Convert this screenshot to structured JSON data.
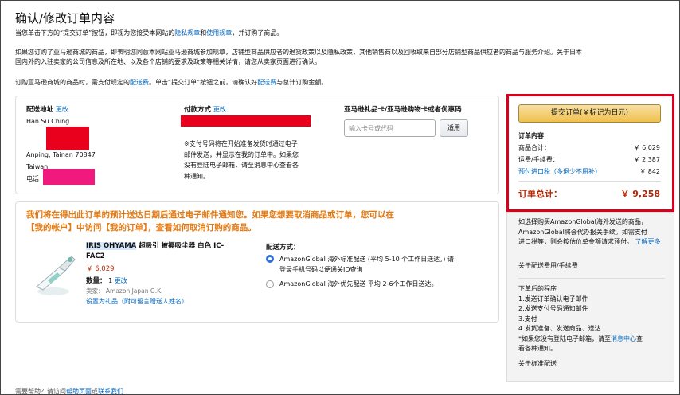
{
  "page_title": "确认/修改订单内容",
  "intro": {
    "p1_a": "当您单击下方的“提交订单”按钮，即视为您接受本网站的",
    "p1_link1": "隐私规章",
    "p1_and": "和",
    "p1_link2": "使用规章",
    "p1_b": "，并订购了商品。",
    "p2_line1": "如果您订购了亚马逊商城的商品，即表明您同意本网站亚马逊商城参加规章，店铺型商品供应者的退货政策以及隐私政策，其他销售商以及回收取来自部分店铺型商品供应者的商品与服务介绍。关于日本",
    "p2_line2": "国内外的入驻卖家的公司信息及所在地、以及各个店铺的要求及政策等相关详情，请您从卖家页面进行确认。",
    "p3_a": "订购亚马逊商城的商品时，需支付规定的",
    "p3_link1": "配送费",
    "p3_b": "。单击“提交订单”按钮之前，请确认好",
    "p3_link2": "配送费",
    "p3_c": "与总计订购金额。"
  },
  "address": {
    "label": "配送地址",
    "change": "更改",
    "name": "Han Su Ching",
    "line_city": "Anping, Tainan 70847",
    "country": "Taiwan",
    "phone_label": "电话"
  },
  "payment": {
    "label": "付款方式",
    "change": "更改",
    "note": [
      "※支付号码将在开始准备发货时通过电子",
      "邮件发送，并显示在我的订单中。如果您",
      "没有登陆电子邮箱，请至消息中心查看各",
      "种通知。"
    ]
  },
  "gift": {
    "label": "亚马逊礼品卡/亚马逊购物卡或者优惠码",
    "placeholder": "输入卡号或代码",
    "apply": "适用"
  },
  "notice": {
    "line1": "我们将在得出此订单的预计送达日期后通过电子邮件通知您。如果您想要取消商品或订单，您可以在",
    "line2": "【我的帐户】中访问【我的订单】，查看如何取消订购的商品。"
  },
  "product": {
    "brand": "IRIS OHYAMA",
    "title_rest": " 超吸引 被褥吸尘器 白色 IC-",
    "title_line2": "FAC2",
    "price": "￥ 6,029",
    "qty_label": "数量：",
    "qty": "1",
    "qty_change": "更改",
    "seller": "卖家： Amazon Japan G.K.",
    "gift_link": "设置为礼品（附可留言赠送人姓名）"
  },
  "shipping": {
    "label": "配送方式：",
    "opt1_line1": "AmazonGlobal 海外标准配送 (平均 5-10 个工作日送达。) 请",
    "opt1_line2": "登录手机号码以便通关ID查询",
    "opt2": "AmazonGlobal 海外优先配送  平均 2-6个工作日送达。"
  },
  "summary": {
    "submit": "提交订单(￥标记为日元)",
    "header": "订单内容",
    "items_label": "商品合计：",
    "items_value": "￥ 6,029",
    "ship_label": "运费/手续费：",
    "ship_value": "￥ 2,387",
    "import_label": "预付进口税（多退少不用补）",
    "import_value": "￥ 842",
    "total_label": "订单总计：",
    "total_value": "￥ 9,258"
  },
  "side_info": {
    "para1": [
      "如选择购买AmazonGlobal海外发送的商品，",
      "AmazonGlobal将会代办报关手续。如需支付",
      "进口税等，则会按估价单金额请求预付。"
    ],
    "para1_link": "了解更多",
    "link_fees": "关于配送费用/手续费",
    "steps_title": "下单后的程序",
    "steps": [
      "1.发送订单确认电子邮件",
      "2.发送支付号码通知邮件",
      "3.支付",
      "4.发货准备、发送商品、送达"
    ],
    "note_a": "*如果您没有登陆电子邮箱，请至",
    "note_link": "消息中心",
    "note_b": "查",
    "note_c": "看各种通知。",
    "link_standard": "关于标准配送"
  },
  "footer": {
    "a": "需要帮助？请访问",
    "link1": "帮助页面",
    "b": "或",
    "link2": "联系我们"
  },
  "colors": {
    "link": "#0066c0",
    "warn": "#e47911",
    "price": "#b12704",
    "highlight_border": "#d9001b"
  }
}
